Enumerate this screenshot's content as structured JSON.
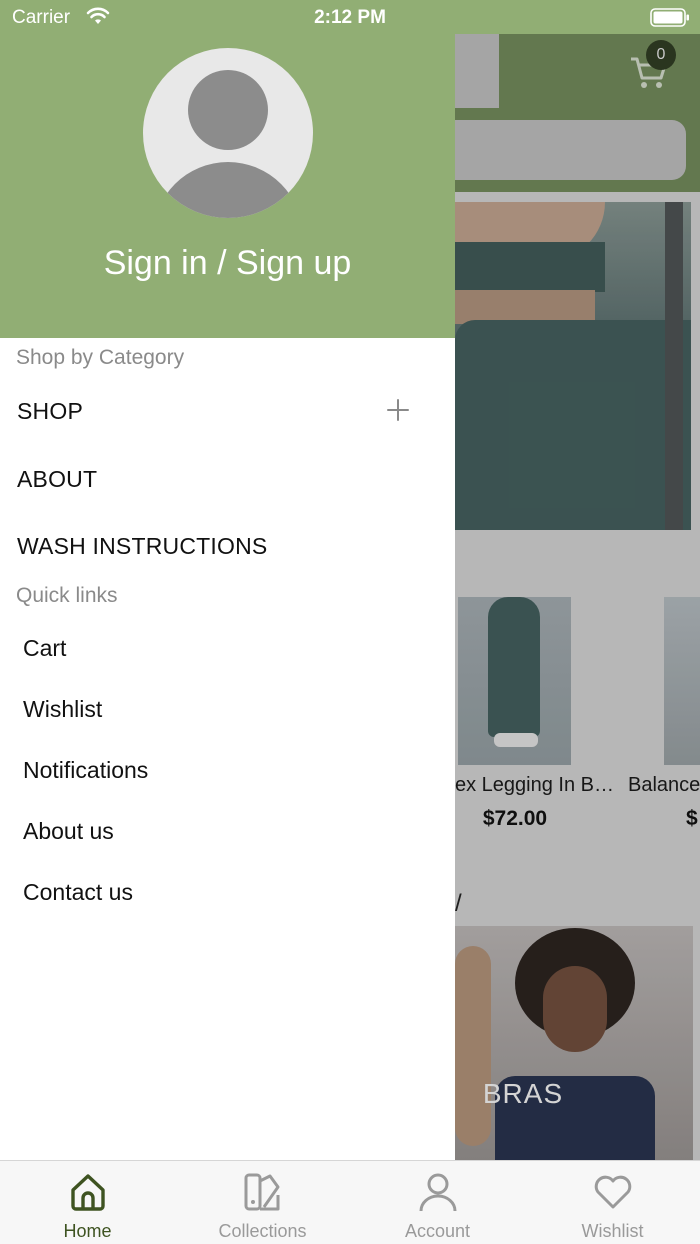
{
  "status_bar": {
    "carrier": "Carrier",
    "time": "2:12 PM"
  },
  "colors": {
    "drawer_header": "#91ae74",
    "active_tab": "#3e5321",
    "inactive_tab": "#9a9a9a"
  },
  "background": {
    "cart_count": "0",
    "product_1": {
      "title": "ex Legging In B…",
      "price": "$72.00"
    },
    "product_2": {
      "title": "Balance",
      "price": "$"
    },
    "section_fragment": "/",
    "collection_banner_label": "BRAS"
  },
  "drawer": {
    "sign_in_label": "Sign in / Sign up",
    "category_section_title": "Shop by Category",
    "categories": [
      {
        "label": "SHOP",
        "expandable": true
      },
      {
        "label": "ABOUT",
        "expandable": false
      },
      {
        "label": "WASH INSTRUCTIONS",
        "expandable": false
      }
    ],
    "quick_links_title": "Quick links",
    "quick_links": [
      {
        "label": "Cart"
      },
      {
        "label": "Wishlist"
      },
      {
        "label": "Notifications"
      },
      {
        "label": "About us"
      },
      {
        "label": "Contact us"
      }
    ]
  },
  "tab_bar": {
    "tabs": [
      {
        "label": "Home",
        "icon": "home-icon",
        "active": true
      },
      {
        "label": "Collections",
        "icon": "collections-icon",
        "active": false
      },
      {
        "label": "Account",
        "icon": "account-icon",
        "active": false
      },
      {
        "label": "Wishlist",
        "icon": "heart-icon",
        "active": false
      }
    ]
  }
}
